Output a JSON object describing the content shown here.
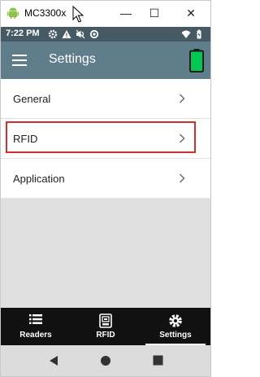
{
  "window": {
    "title": "MC3300x",
    "app_icon": "android-icon",
    "minimize_glyph": "—",
    "maximize_glyph": "☐",
    "close_glyph": "✕"
  },
  "statusbar": {
    "time": "7:22 PM",
    "icons_left": [
      "gear-icon",
      "warning-icon",
      "mute-icon",
      "sync-icon"
    ],
    "icons_right": [
      "wifi-icon",
      "battery-charging-icon"
    ]
  },
  "appbar": {
    "title": "Settings",
    "menu_icon": "hamburger-menu-icon",
    "battery_icon": "battery-full-icon",
    "battery_color": "#00c853"
  },
  "settings_list": {
    "items": [
      {
        "label": "General"
      },
      {
        "label": "RFID",
        "highlighted": true
      },
      {
        "label": "Application"
      }
    ],
    "highlight_color": "#d32f2f"
  },
  "bottom_nav": {
    "items": [
      {
        "label": "Readers",
        "icon": "list-icon",
        "active": false
      },
      {
        "label": "RFID",
        "icon": "rfid-tag-icon",
        "active": false
      },
      {
        "label": "Settings",
        "icon": "gear-icon",
        "active": true
      }
    ]
  },
  "system_nav": {
    "buttons": [
      "back-icon",
      "home-icon",
      "recents-icon"
    ]
  },
  "colors": {
    "statusbar": "#455a64",
    "appbar": "#607d8b",
    "bottom_nav": "#111111",
    "content_bg": "#e0e0e0"
  }
}
